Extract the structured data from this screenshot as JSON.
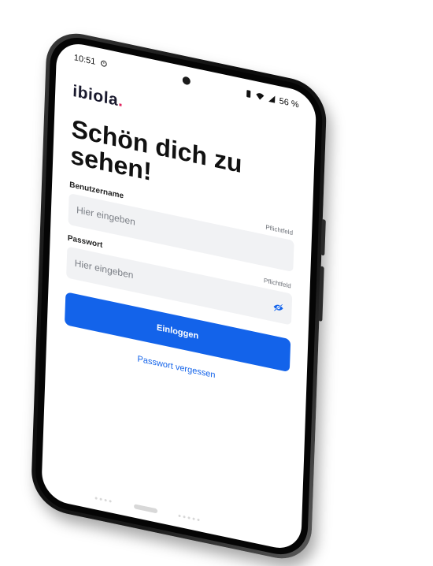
{
  "status_bar": {
    "time": "10:51",
    "alarm_icon": "alarm-clock-icon",
    "battery_percent": "56 %",
    "icons": [
      "vibrate-icon",
      "wifi-icon",
      "signal-icon"
    ]
  },
  "brand": {
    "logo_text": "ibiola",
    "logo_dot": ".",
    "accent_color": "#e0245e"
  },
  "login": {
    "headline": "Schön dich zu sehen!",
    "username": {
      "label": "Benutzername",
      "placeholder": "Hier eingeben",
      "required_hint": "Pflichtfeld"
    },
    "password": {
      "label": "Passwort",
      "placeholder": "Hier eingeben",
      "required_hint": "Pflichtfeld",
      "toggle_icon": "eye-slash-icon"
    },
    "submit_label": "Einloggen",
    "forgot_label": "Passwort vergessen",
    "primary_color": "#1363ea"
  }
}
